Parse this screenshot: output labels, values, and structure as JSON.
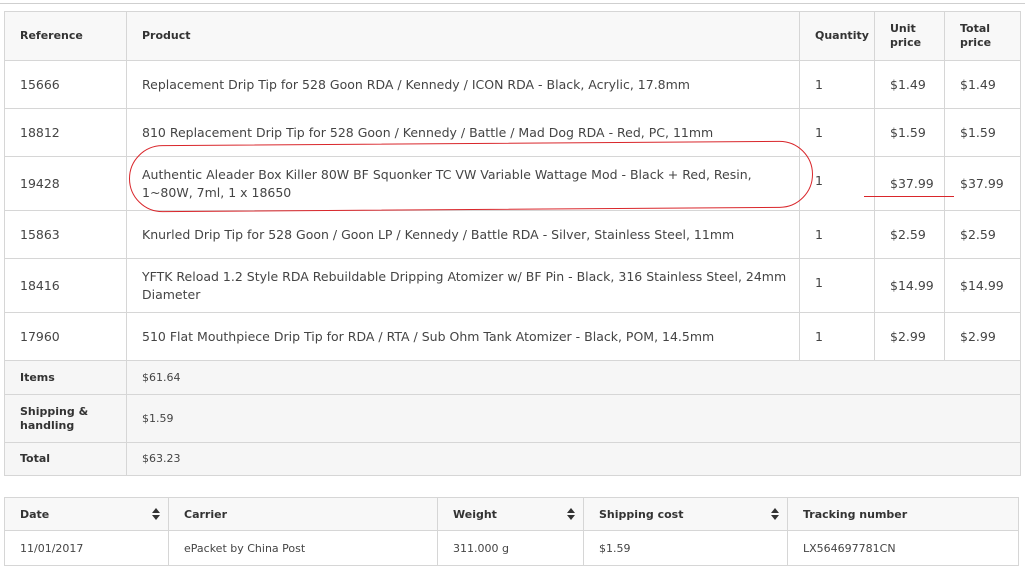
{
  "order": {
    "headers": {
      "reference": "Reference",
      "product": "Product",
      "quantity": "Quantity",
      "unit_price": "Unit price",
      "total_price": "Total price"
    },
    "rows": [
      {
        "reference": "15666",
        "product": "Replacement Drip Tip for 528 Goon RDA / Kennedy / ICON RDA - Black, Acrylic, 17.8mm",
        "quantity": "1",
        "unit_price": "$1.49",
        "total_price": "$1.49"
      },
      {
        "reference": "18812",
        "product": "810 Replacement Drip Tip for 528 Goon / Kennedy / Battle / Mad Dog RDA - Red, PC, 11mm",
        "quantity": "1",
        "unit_price": "$1.59",
        "total_price": "$1.59"
      },
      {
        "reference": "19428",
        "product": "Authentic Aleader Box Killer 80W BF Squonker TC VW Variable Wattage Mod - Black + Red, Resin, 1~80W, 7ml, 1 x 18650",
        "quantity": "1",
        "unit_price": "$37.99",
        "total_price": "$37.99"
      },
      {
        "reference": "15863",
        "product": "Knurled Drip Tip for 528 Goon / Goon LP / Kennedy / Battle RDA - Silver, Stainless Steel, 11mm",
        "quantity": "1",
        "unit_price": "$2.59",
        "total_price": "$2.59"
      },
      {
        "reference": "18416",
        "product": "YFTK Reload 1.2 Style RDA Rebuildable Dripping Atomizer w/ BF Pin - Black, 316 Stainless Steel, 24mm Diameter",
        "quantity": "1",
        "unit_price": "$14.99",
        "total_price": "$14.99"
      },
      {
        "reference": "17960",
        "product": "510 Flat Mouthpiece Drip Tip for RDA / RTA / Sub Ohm Tank Atomizer - Black, POM, 14.5mm",
        "quantity": "1",
        "unit_price": "$2.99",
        "total_price": "$2.99"
      }
    ],
    "summary": {
      "items_label": "Items",
      "items_value": "$61.64",
      "shipping_label": "Shipping & handling",
      "shipping_value": "$1.59",
      "total_label": "Total",
      "total_value": "$63.23"
    }
  },
  "shipping": {
    "headers": {
      "date": "Date",
      "carrier": "Carrier",
      "weight": "Weight",
      "shipping_cost": "Shipping cost",
      "tracking_number": "Tracking number"
    },
    "row": {
      "date": "11/01/2017",
      "carrier": "ePacket by China Post",
      "weight": "311.000 g",
      "shipping_cost": "$1.59",
      "tracking_number": "LX564697781CN"
    }
  },
  "annotation_color": "#d9262b",
  "icons": {
    "sort": "sort-arrows-icon"
  }
}
